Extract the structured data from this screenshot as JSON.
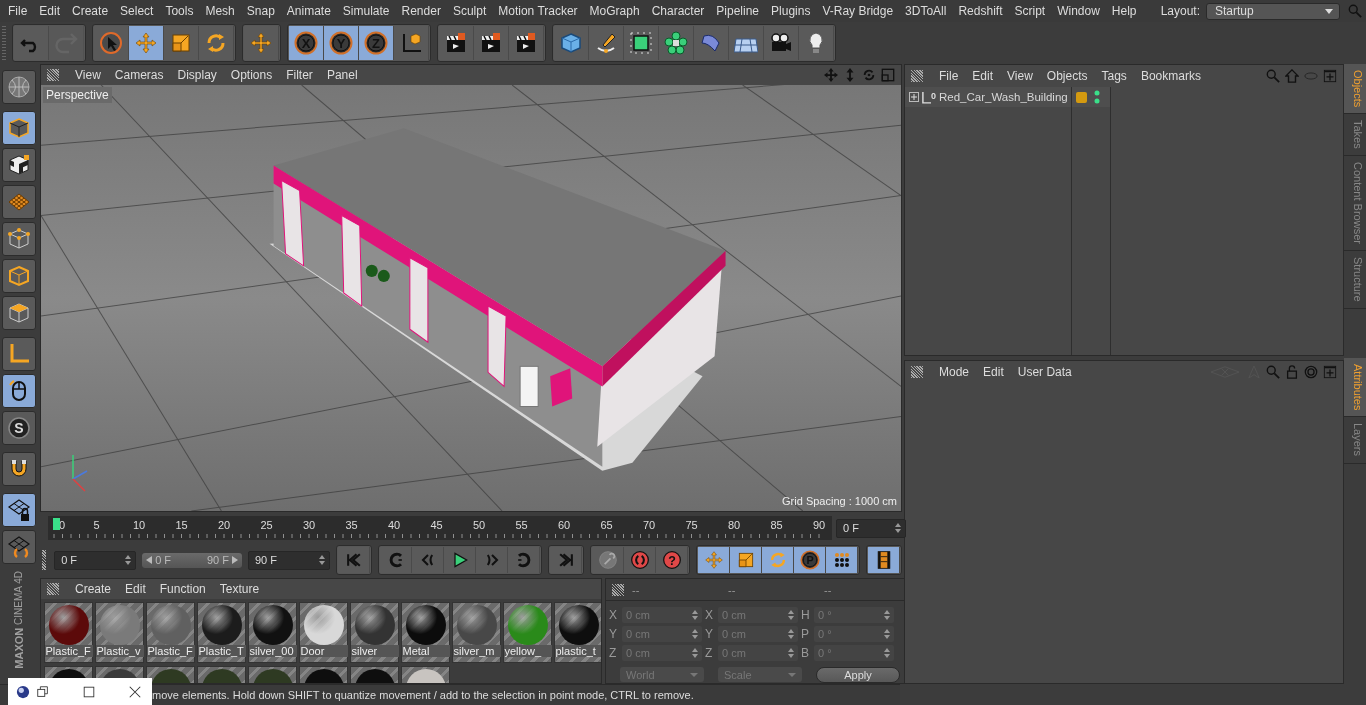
{
  "menu_bar": {
    "items": [
      "File",
      "Edit",
      "Create",
      "Select",
      "Tools",
      "Mesh",
      "Snap",
      "Animate",
      "Simulate",
      "Render",
      "Sculpt",
      "Motion Tracker",
      "MoGraph",
      "Character",
      "Pipeline",
      "Plugins",
      "V-Ray Bridge",
      "3DToAll",
      "Redshift",
      "Script",
      "Window",
      "Help"
    ],
    "layout_label": "Layout:",
    "layout_value": "Startup"
  },
  "toolbar": [
    {
      "tools": [
        {
          "kind": "undo",
          "selected": false,
          "disabled": false
        },
        {
          "kind": "redo",
          "selected": false,
          "disabled": true
        }
      ]
    },
    {
      "tools": [
        {
          "kind": "select",
          "selected": false,
          "disabled": false
        },
        {
          "kind": "move",
          "selected": true,
          "disabled": false
        },
        {
          "kind": "scale",
          "selected": false,
          "disabled": false
        },
        {
          "kind": "rotate",
          "selected": false,
          "disabled": false
        }
      ]
    },
    {
      "tools": [
        {
          "kind": "transform",
          "selected": false,
          "disabled": false
        }
      ]
    },
    {
      "tools": [
        {
          "kind": "axis",
          "label": "X",
          "selected": true,
          "disabled": false
        },
        {
          "kind": "axis",
          "label": "Y",
          "selected": true,
          "disabled": false
        },
        {
          "kind": "axis",
          "label": "Z",
          "selected": true,
          "disabled": false
        },
        {
          "kind": "coords",
          "selected": false,
          "disabled": false
        }
      ]
    },
    {
      "tools": [
        {
          "kind": "clapper",
          "selected": false,
          "disabled": false
        },
        {
          "kind": "clapper",
          "selected": false,
          "disabled": false
        },
        {
          "kind": "clapper",
          "selected": false,
          "disabled": false
        }
      ]
    },
    {
      "tools": [
        {
          "kind": "cube",
          "selected": false,
          "disabled": false
        },
        {
          "kind": "pen",
          "selected": false,
          "disabled": false
        },
        {
          "kind": "subdiv",
          "selected": false,
          "disabled": false
        },
        {
          "kind": "cloner",
          "selected": false,
          "disabled": false
        },
        {
          "kind": "deformer",
          "selected": false,
          "disabled": false
        },
        {
          "kind": "floor",
          "selected": false,
          "disabled": false
        },
        {
          "kind": "camera",
          "selected": false,
          "disabled": false
        },
        {
          "kind": "light",
          "selected": false,
          "disabled": false
        }
      ]
    }
  ],
  "left_tools": [
    {
      "kind": "globe",
      "selected": false
    },
    {
      "kind": "model",
      "selected": true
    },
    {
      "kind": "texture",
      "selected": false
    },
    {
      "kind": "workplane",
      "selected": false
    },
    {
      "kind": "points",
      "selected": false
    },
    {
      "kind": "edges",
      "selected": false
    },
    {
      "kind": "polygons",
      "selected": false
    },
    {
      "kind": "axisl",
      "selected": false
    },
    {
      "kind": "mouse",
      "selected": true
    },
    {
      "kind": "snap",
      "label": "S",
      "selected": false
    },
    {
      "kind": "magnet",
      "selected": false
    },
    {
      "kind": "wplock",
      "selected": true
    },
    {
      "kind": "wprot",
      "selected": false
    }
  ],
  "viewport": {
    "menu": [
      "View",
      "Cameras",
      "Display",
      "Options",
      "Filter",
      "Panel"
    ],
    "camera_label": "Perspective",
    "grid_spacing": "Grid Spacing : 1000 cm"
  },
  "timeline": {
    "frames": [
      "0",
      "5",
      "10",
      "15",
      "20",
      "25",
      "30",
      "35",
      "40",
      "45",
      "50",
      "55",
      "60",
      "65",
      "70",
      "75",
      "80",
      "85",
      "90"
    ],
    "current_frame": "0 F"
  },
  "transport": {
    "start_field": "0 F",
    "range_start": "0 F",
    "range_end": "90 F",
    "level": 1,
    "end_field": "90 F",
    "groups": [
      {
        "buttons": [
          {
            "kind": "start"
          }
        ]
      },
      {
        "buttons": [
          {
            "kind": "prevkey"
          },
          {
            "kind": "prevframe"
          },
          {
            "kind": "play"
          },
          {
            "kind": "nextframe"
          },
          {
            "kind": "nextkey"
          }
        ]
      },
      {
        "buttons": [
          {
            "kind": "end"
          }
        ]
      },
      {
        "buttons": [
          {
            "kind": "key"
          },
          {
            "kind": "autokey"
          },
          {
            "kind": "help",
            "label": "?"
          }
        ]
      },
      {
        "buttons": [
          {
            "kind": "move"
          },
          {
            "kind": "scale"
          },
          {
            "kind": "rotate"
          },
          {
            "kind": "param",
            "label": "P"
          },
          {
            "kind": "dots"
          }
        ]
      },
      {
        "buttons": [
          {
            "kind": "film"
          }
        ]
      }
    ]
  },
  "materials": {
    "menu": [
      "Create",
      "Edit",
      "Function",
      "Texture"
    ],
    "items": [
      {
        "name": "Plastic_F",
        "color": "#5c0a0a"
      },
      {
        "name": "Plastic_v",
        "color": "#7a7a7a"
      },
      {
        "name": "Plastic_F",
        "color": "#606060"
      },
      {
        "name": "Plastic_T",
        "color": "#1c1c1c"
      },
      {
        "name": "silver_00",
        "color": "#111111"
      },
      {
        "name": "Door",
        "color": "#d8d8d8"
      },
      {
        "name": "silver",
        "color": "#333333"
      },
      {
        "name": "Metal",
        "color": "#0c0c0c"
      },
      {
        "name": "silver_m",
        "color": "#484848"
      },
      {
        "name": "yellow_",
        "color": "#2a8a1a"
      },
      {
        "name": "plastic_t",
        "color": "#0e0e0e"
      }
    ],
    "row_2": [
      {
        "color": "#0e0e0e"
      },
      {
        "color": "#3a3a3a"
      },
      {
        "color": "#2e3a22"
      },
      {
        "color": "#2e3a22"
      },
      {
        "color": "#2e3a22"
      },
      {
        "color": "#0e0e0e"
      },
      {
        "color": "#0e0e0e"
      },
      {
        "color": "#c8c4c0"
      }
    ]
  },
  "coordinates": {
    "headers": [
      "--",
      "--",
      "--"
    ],
    "rows": [
      {
        "axis_1": "X",
        "value_1": "0 cm",
        "axis_2": "X",
        "value_2": "0 cm",
        "axis_3": "H",
        "value_3": "0 °"
      },
      {
        "axis_1": "Y",
        "value_1": "0 cm",
        "axis_2": "Y",
        "value_2": "0 cm",
        "axis_3": "P",
        "value_3": "0 °"
      },
      {
        "axis_1": "Z",
        "value_1": "0 cm",
        "axis_2": "Z",
        "value_2": "0 cm",
        "axis_3": "B",
        "value_3": "0 °"
      }
    ],
    "mode_dropdown": "World",
    "type_dropdown": "Scale",
    "apply": "Apply"
  },
  "status_bar": {
    "text": "move elements. Hold down SHIFT to quantize movement / add to the selection in point mode, CTRL to remove."
  },
  "logo": {
    "brand": "MAXON",
    "product": "CINEMA 4D"
  },
  "objects": {
    "menu": [
      "File",
      "Edit",
      "View",
      "Objects",
      "Tags",
      "Bookmarks"
    ],
    "items": [
      {
        "name": "Red_Car_Wash_Building",
        "icon_label": "0",
        "expanded": false
      }
    ]
  },
  "attributes": {
    "menu": [
      "Mode",
      "Edit",
      "User Data"
    ]
  },
  "side_tabs_top": [
    {
      "label": "Objects",
      "selected": true
    },
    {
      "label": "Takes",
      "selected": false
    },
    {
      "label": "Content Browser",
      "selected": false
    },
    {
      "label": "Structure",
      "selected": false
    }
  ],
  "side_tabs_bottom": [
    {
      "label": "Attributes",
      "selected": true
    },
    {
      "label": "Layers",
      "selected": false
    }
  ]
}
